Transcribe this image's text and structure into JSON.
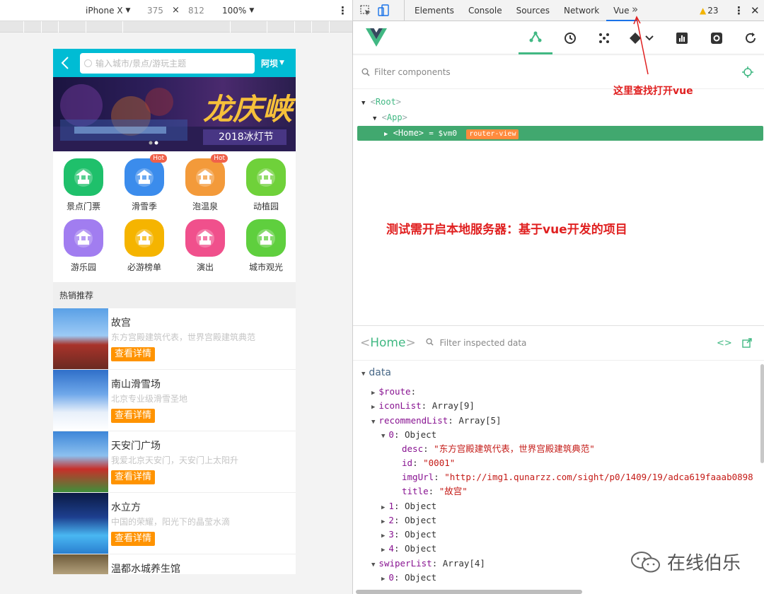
{
  "device_toolbar": {
    "device": "iPhone X",
    "width": "375",
    "times": "×",
    "height": "812",
    "zoom": "100%"
  },
  "phone": {
    "search_placeholder": "输入城市/景点/游玩主题",
    "city": "阿坝",
    "banner": {
      "title": "龙庆峡",
      "subtitle": "2018冰灯节"
    },
    "icons": [
      {
        "label": "景点门票",
        "color": "#1fc06b",
        "hot": ""
      },
      {
        "label": "滑雪季",
        "color": "#3b8cec",
        "hot": "Hot"
      },
      {
        "label": "泡温泉",
        "color": "#f39a3a",
        "hot": "Hot"
      },
      {
        "label": "动植园",
        "color": "#6fd13a",
        "hot": ""
      },
      {
        "label": "游乐园",
        "color": "#a17df0",
        "hot": ""
      },
      {
        "label": "必游榜单",
        "color": "#f5b400",
        "hot": ""
      },
      {
        "label": "演出",
        "color": "#f0508c",
        "hot": ""
      },
      {
        "label": "城市观光",
        "color": "#5fcf3e",
        "hot": ""
      }
    ],
    "section_title": "热销推荐",
    "recommend": [
      {
        "title": "故宫",
        "desc": "东方宫殿建筑代表，世界宫殿建筑典范",
        "button": "查看详情"
      },
      {
        "title": "南山滑雪场",
        "desc": "北京专业级滑雪圣地",
        "button": "查看详情"
      },
      {
        "title": "天安门广场",
        "desc": "我爱北京天安门，天安门上太阳升",
        "button": "查看详情"
      },
      {
        "title": "水立方",
        "desc": "中国的荣耀，阳光下的晶莹水滴",
        "button": "查看详情"
      },
      {
        "title": "温都水城养生馆",
        "desc": "",
        "button": ""
      }
    ]
  },
  "devtools": {
    "tabs": [
      "Elements",
      "Console",
      "Sources",
      "Network",
      "Vue"
    ],
    "active_tab": "Vue",
    "more": "»",
    "warnings": "23",
    "filter_components": "Filter components",
    "tree": {
      "root": "Root",
      "app": "App",
      "home": "Home",
      "home_suffix": "= $vm0",
      "badge": "router-view"
    },
    "inspected_component": "Home",
    "filter_inspected": "Filter inspected data",
    "data_lines": [
      {
        "key": "data",
        "value": ""
      },
      {
        "key": "$route",
        "value": ""
      },
      {
        "key": "iconList",
        "value": "Array[9]"
      },
      {
        "key": "recommendList",
        "value": "Array[5]"
      },
      {
        "key": "0",
        "value": "Object"
      },
      {
        "key": "desc",
        "value": "\"东方宫殿建筑代表，世界宫殿建筑典范\""
      },
      {
        "key": "id",
        "value": "\"0001\""
      },
      {
        "key": "imgUrl",
        "value": "\"http://img1.qunarzz.com/sight/p0/1409/19/adca619faaab0898"
      },
      {
        "key": "title",
        "value": "\"故宫\""
      },
      {
        "key": "1",
        "value": "Object"
      },
      {
        "key": "2",
        "value": "Object"
      },
      {
        "key": "3",
        "value": "Object"
      },
      {
        "key": "4",
        "value": "Object"
      },
      {
        "key": "swiperList",
        "value": "Array[4]"
      },
      {
        "key": "0",
        "value": "Object"
      }
    ]
  },
  "annotations": {
    "find_vue": "这里查找打开vue",
    "server_note": "测试需开启本地服务器：基于vue开发的项目"
  },
  "watermark": "在线伯乐",
  "colors": {
    "vue_green": "#41b883",
    "cyan_header": "#00bcd4",
    "orange": "#ff9300",
    "annotation_red": "#e02020"
  }
}
